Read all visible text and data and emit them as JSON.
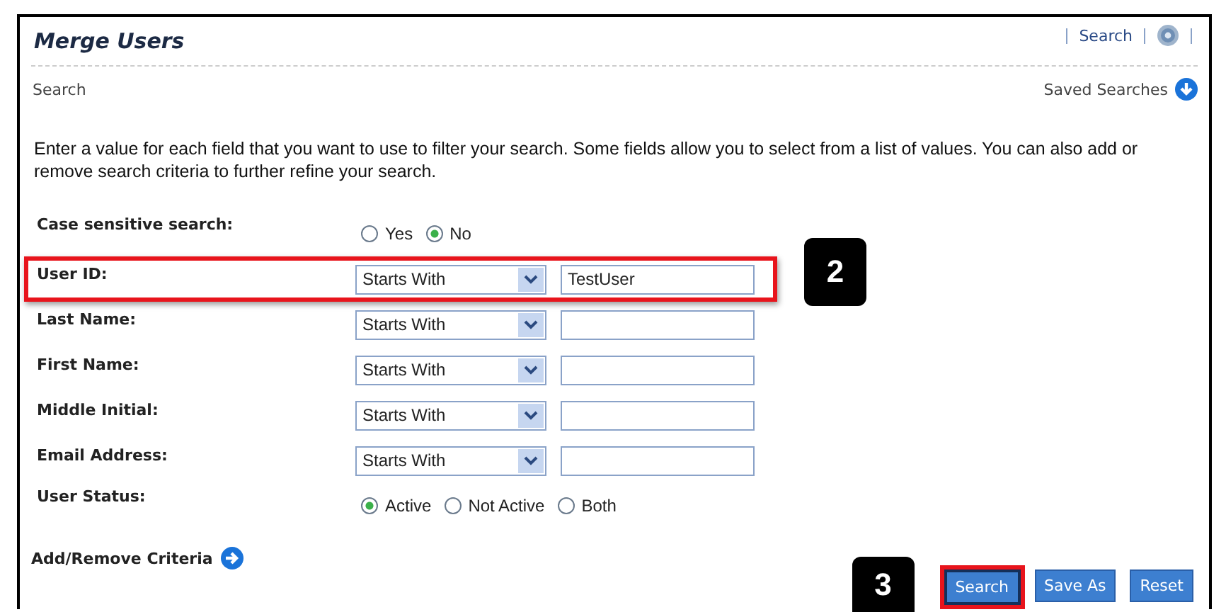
{
  "title": "Merge Users",
  "header_links": [
    {
      "kind": "text",
      "label": "Search"
    },
    {
      "kind": "help"
    }
  ],
  "section": {
    "title": "Search",
    "saved_searches": "Saved Searches"
  },
  "intro": "Enter a value for each field that you want to use to filter your search. Some fields allow you to select from a list of values. You can also add or remove search criteria to further refine your search.",
  "criteria": [
    {
      "kind": "radio",
      "label": "Case sensitive search:",
      "options": [
        {
          "label": "Yes",
          "selected": false
        },
        {
          "label": "No",
          "selected": true
        }
      ]
    },
    {
      "kind": "text",
      "label": "User ID:",
      "operator": "Starts With",
      "value": "TestUser",
      "highlighted": true,
      "callout": "2"
    },
    {
      "kind": "text",
      "label": "Last Name:",
      "operator": "Starts With",
      "highlighted": false
    },
    {
      "kind": "text",
      "label": "First Name:",
      "operator": "Starts With",
      "highlighted": false
    },
    {
      "kind": "text",
      "label": "Middle Initial:",
      "operator": "Starts With",
      "highlighted": false
    },
    {
      "kind": "text",
      "label": "Email Address:",
      "operator": "Starts With",
      "highlighted": false
    },
    {
      "kind": "radio",
      "label": "User Status:",
      "options": [
        {
          "label": "Active",
          "selected": true
        },
        {
          "label": "Not Active",
          "selected": false
        },
        {
          "label": "Both",
          "selected": false
        }
      ]
    }
  ],
  "add_remove": "Add/Remove Criteria",
  "buttons": [
    {
      "label": "Search",
      "highlighted": true,
      "callout": "3"
    },
    {
      "label": "Save As",
      "highlighted": false
    },
    {
      "label": "Reset",
      "highlighted": false
    }
  ]
}
